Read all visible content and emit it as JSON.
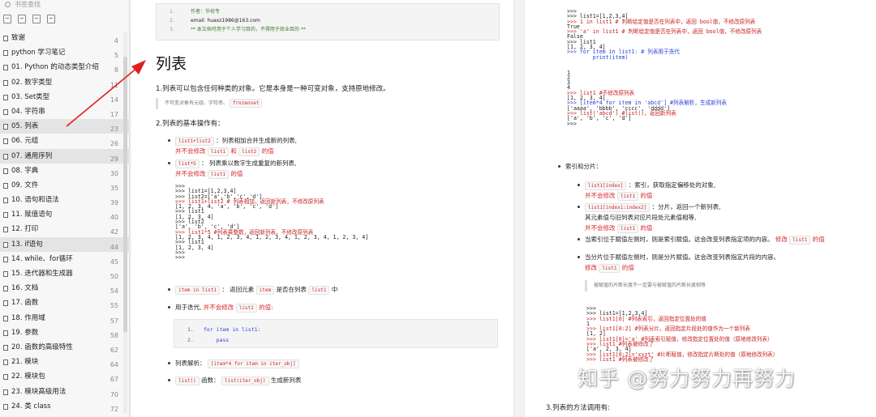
{
  "sidebar": {
    "search_placeholder": "书签查找",
    "items": [
      {
        "label": "致谢",
        "page": "4"
      },
      {
        "label": "python 学习笔记",
        "page": "5"
      },
      {
        "label": "01. Python 的动态类型介绍",
        "page": "8"
      },
      {
        "label": "02. 数字类型",
        "page": "11"
      },
      {
        "label": "03. Set类型",
        "page": "14"
      },
      {
        "label": "04. 字符串",
        "page": "17"
      },
      {
        "label": "05. 列表",
        "page": "23"
      },
      {
        "label": "06. 元组",
        "page": "26"
      },
      {
        "label": "07. 通用序列",
        "page": "29"
      },
      {
        "label": "08. 字典",
        "page": "30"
      },
      {
        "label": "09. 文件",
        "page": "35"
      },
      {
        "label": "10. 语句和语法",
        "page": "39"
      },
      {
        "label": "11. 赋值语句",
        "page": "40"
      },
      {
        "label": "12. 打印",
        "page": "42"
      },
      {
        "label": "13. if语句",
        "page": "44"
      },
      {
        "label": "14. while、for循环",
        "page": "45"
      },
      {
        "label": "15. 迭代器和生成器",
        "page": "50"
      },
      {
        "label": "16. 文档",
        "page": "54"
      },
      {
        "label": "17. 函数",
        "page": "55"
      },
      {
        "label": "18. 作用域",
        "page": "57"
      },
      {
        "label": "19. 参数",
        "page": "58"
      },
      {
        "label": "20. 函数的高级特性",
        "page": "62"
      },
      {
        "label": "21. 模块",
        "page": "64"
      },
      {
        "label": "22. 模块包",
        "page": "67"
      },
      {
        "label": "23. 模块高级用法",
        "page": "70"
      },
      {
        "label": "24. 类 class",
        "page": "72"
      }
    ]
  },
  "left_page": {
    "header_lines": [
      {
        "num": "1.",
        "text": "作者：华校专"
      },
      {
        "num": "2.",
        "text": "email: huaxz1986@163.com"
      },
      {
        "num": "3.",
        "text": "**  本文档可用于个人学习目的，不得用于商业目的  **"
      }
    ],
    "title": "列表",
    "intro": "1.列表可以包含任何种类的对象。它是本身是一种可变对象，支持原地修改。",
    "quote_text": "不可变对象有元组、字符串、",
    "quote_tag": "frozenset",
    "section2": "2.列表的基本操作有：",
    "b1_tag": "list1+list2",
    "b1_text": "：列表相加合并生成新的列表,",
    "b1_red_pre": "并不会修改",
    "b1_red_tag1": "list1",
    "b1_red_mid": "和",
    "b1_red_tag2": "list2",
    "b1_red_post": "的值",
    "b2_tag": "list*5",
    "b2_text": "：  列表乘以数字生成重复的新列表,",
    "b2_red_pre": "并不会修改",
    "b2_red_tag": "list1",
    "b2_red_post": "的值",
    "code1": [
      ">>>",
      ">>> list1=[1,2,3,4]",
      ">>> list2=['a','b','c','d']",
      ">>> list1+list2 # 列表相加，返回新列表，不修改原列表",
      "[1, 2, 3, 4, 'a', 'b', 'c', 'd']",
      ">>> list1",
      "[1, 2, 3, 4]",
      ">>> list2",
      "['a', 'b', 'c', 'd']",
      ">>> list1*5 #列表乘整数，返回新列表，不修改原列表",
      "[1, 2, 3, 4, 1, 2, 3, 4, 1, 2, 3, 4, 1, 2, 3, 4, 1, 2, 3, 4]",
      ">>> list1",
      "[1, 2, 3, 4]",
      ">>>",
      ">>>"
    ],
    "b3_tag1": "item in list1",
    "b3_text1": "： 返回元素",
    "b3_tag2": "item",
    "b3_text2": "是否在列表",
    "b3_tag3": "list1",
    "b3_text3": "中",
    "b4_text": "用于迭代,",
    "b4_red": "并不会修改",
    "b4_tag": "list1",
    "b4_red2": "的值:",
    "loop_lines": [
      {
        "num": "1.",
        "text": "for item in list1:"
      },
      {
        "num": "2.",
        "text": "    pass"
      }
    ],
    "b5_text": "列表解析：",
    "b5_tag": "[item*4 for item in iter_obj]",
    "b6_tag1": "list()",
    "b6_text": "函数：",
    "b6_tag2": "list(iter_obj)",
    "b6_text2": "生成新列表"
  },
  "right_page": {
    "code2": [
      ">>>",
      ">>> list1=[1,2,3,4]",
      ">>> 1 in list1 # 判断给定值是否在列表中，返回 bool值，不修改原列表",
      "True",
      ">>> 'a' in list1 # 判断给定值是否在列表中，返回 bool值，不修改原列表",
      "False",
      ">>> list1",
      "[1, 2, 3, 4]",
      ">>> for item in list1: # 列表用于迭代",
      "        print(item)",
      "",
      "",
      "1",
      "2",
      "3",
      "4",
      ">>> list1 #不修改原列表",
      "[1, 2, 3, 4]",
      ">>> [item*4 for item in 'abcd'] #列表解析，生成新列表",
      "['aaaa', 'bbbb', 'cccc', 'dddd']",
      ">>> list('abcd') #list()，返回新列表",
      "['a', 'b', 'c', 'd']",
      ">>>"
    ],
    "index_heading": "索引和分片：",
    "i1_tag": "list1[index]",
    "i1_text": "：索引，获取指定偏移处的对象,",
    "i1_red_pre": "并不会修改",
    "i1_red_tag": "list1",
    "i1_red_post": "的值",
    "i2_tag": "list1[index1:index2]",
    "i2_text": "：分片，返回一个新列表,",
    "i2_text2": "其元素值与旧列表对应片段处元素值相等,",
    "i2_red_pre": "并不会修改",
    "i2_red_tag": "list1",
    "i2_red_post": "的值",
    "i3_text": "当索引位于赋值左侧时，则是索引赋值。这会改变列表指定项的内容。",
    "i3_red": "修改",
    "i3_tag": "list1",
    "i3_red2": "的值",
    "i4_text": "当分片位于赋值左侧时，则是分片赋值。这会改变列表指定片段的内容。",
    "i4_red": "修改",
    "i4_tag": "list1",
    "i4_red2": "的值",
    "note": "被赋值的片断长度不一定要与被赋值的片断长度相等",
    "code3": [
      ">>>",
      ">>> list1=[1,2,3,4]",
      ">>> list1[0] #列表索引，返回指定位置处的值",
      "1",
      ">>> list1[0:2] #列表分片，返回指定片段处的值作为一个新列表",
      "[1, 2]",
      ">>> list1[0]='a' #列表索引赋值，修改指定位置处的值（原地修改列表）",
      ">>> list1 #列表被修改了",
      "['a', 2, 3, 4]",
      ">>> list1[0:2]='xyzt' #片断赋值，修改指定片断处的值（原地修改列表）",
      ">>> list1 #列表被修改了"
    ],
    "section3": "3.列表的方法调用有:",
    "watermark": "知乎 @努力努力再努力"
  }
}
